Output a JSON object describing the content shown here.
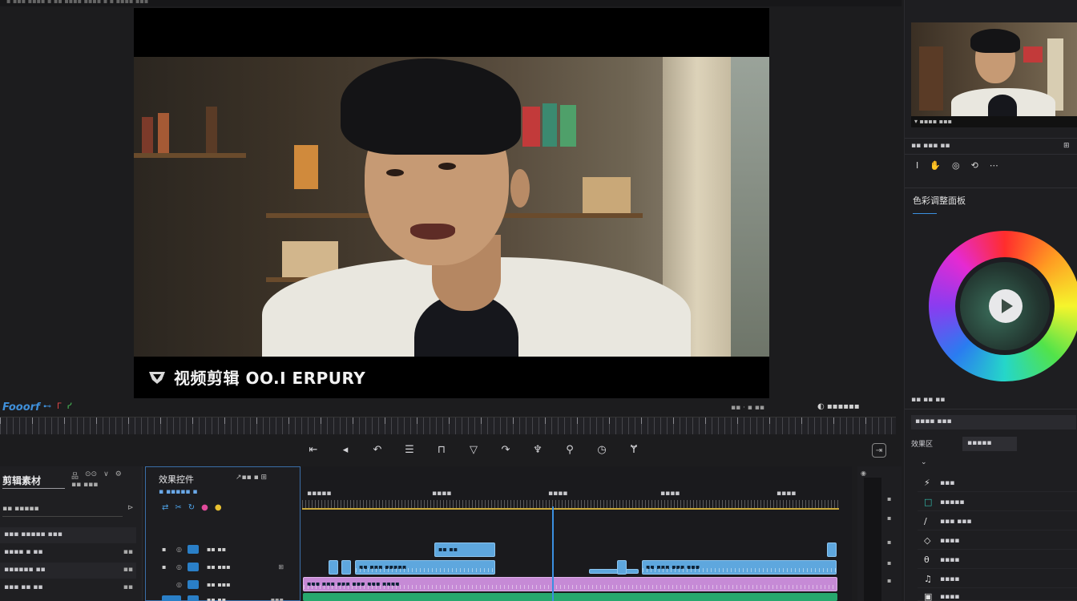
{
  "topbar": {
    "text": "▪ ▪▪▪ ▪▪▪▪ ▪ ▪▪ ▪▪▪▪ ▪▪▪▪ ▪ ▪ ▪▪▪▪ ▪▪▪"
  },
  "program": {
    "caption_text": "视频剪辑 OO.I ERPURY",
    "caption_icon": "shield-logo-icon"
  },
  "monitor_footer": {
    "brand": "Fooorf",
    "time_left": "▪▪ · ▪ ▪▪",
    "time_right": "◐ ▪▪▪▪▪▪"
  },
  "transport": {
    "buttons": [
      {
        "label": "⇤",
        "icon": "mark-in-icon"
      },
      {
        "label": "◂",
        "icon": "step-back-icon"
      },
      {
        "label": "↶",
        "icon": "rewind-icon"
      },
      {
        "label": "☰",
        "icon": "list-icon"
      },
      {
        "label": "⊓",
        "icon": "mark-out-icon"
      },
      {
        "label": "▽",
        "icon": "filter-icon"
      },
      {
        "label": "↷",
        "icon": "forward-icon"
      },
      {
        "label": "♆",
        "icon": "trim-icon"
      },
      {
        "label": "⚲",
        "icon": "extract-icon"
      },
      {
        "label": "◷",
        "icon": "clock-icon"
      },
      {
        "label": "Ɏ",
        "icon": "lift-icon"
      }
    ],
    "export_label": "⇥"
  },
  "project": {
    "title": "剪辑素材",
    "tools": [
      "品",
      "⊙⊙",
      "∨",
      "⚙"
    ],
    "sub": "▪▪ ▪▪▪",
    "search": "▪▪ ▪▪▪▪▪",
    "rows": [
      {
        "label": "▪▪▪ ▪▪▪▪▪ ▪▪▪",
        "right": ""
      },
      {
        "label": "▪▪▪▪ ▪ ▪▪",
        "right": "▪▪"
      },
      {
        "label": "▪▪▪▪▪▪ ▪▪",
        "right": "▪▪"
      },
      {
        "label": "▪▪▪ ▪▪ ▪▪",
        "right": "▪▪"
      }
    ]
  },
  "fx": {
    "title": "效果控件",
    "title_right": "↗▪▪ ▪ ⊞",
    "sub": "▪ ▪▪▪▪▪ ▪",
    "tools": [
      "⇄",
      "✂",
      "↻",
      "●",
      "●"
    ],
    "tracks": [
      {
        "lbl": "▪",
        "ic": "◎",
        "name": "▪▪ ▪▪",
        "r": ""
      },
      {
        "lbl": "▪",
        "ic": "◎",
        "name": "▪▪ ▪▪▪",
        "r": "⊞"
      },
      {
        "lbl": "",
        "ic": "◎",
        "name": "▪▪ ▪▪▪",
        "r": ""
      },
      {
        "lbl": "",
        "ic": "",
        "name": "▪▪ ▪▪",
        "r": "▪▪▪"
      }
    ]
  },
  "timeline": {
    "labels": [
      "▪▪▪▪▪",
      "▪▪▪▪",
      "▪▪▪▪",
      "▪▪▪▪",
      "▪▪▪▪"
    ],
    "clips": {
      "c1": "▪▪ ▪▪",
      "c2": "▪▪ ▪▪▪ ▪▪▪▪▪",
      "c3": "▪▪ ▪▪▪ ▪▪▪ ▪▪▪",
      "c4": "▪▪▪ ▪▪▪ ▪▪▪ ▪▪▪ ▪▪▪ ▪▪▪▪"
    }
  },
  "meter": {
    "labels": [
      "▪",
      "▪",
      "▪",
      "▪",
      "▪"
    ]
  },
  "right": {
    "thumb_bar": "▾ ▪▪▪▪ ▪▪▪",
    "row1": "▪▪ ▪▪▪ ▪▪",
    "tools": [
      "I",
      "✋",
      "◎",
      "⟲",
      "⋯"
    ],
    "color_title": "色彩调整面板",
    "wheel_label": "▪▪ ▪▪ ▪▪",
    "panel_btn": "▪▪▪▪ ▪▪▪",
    "tab1": "效果区",
    "tab2": "▪▪▪▪▪",
    "items": [
      {
        "icon": "⚡",
        "label": "▪▪▪"
      },
      {
        "icon": "□",
        "label": "▪▪▪▪▪"
      },
      {
        "icon": "∕",
        "label": "▪▪▪ ▪▪▪"
      },
      {
        "icon": "◇",
        "label": "▪▪▪▪"
      },
      {
        "icon": "θ",
        "label": "▪▪▪▪"
      },
      {
        "icon": "♫",
        "label": "▪▪▪▪"
      },
      {
        "icon": "▣",
        "label": "▪▪▪▪"
      }
    ]
  },
  "colors": {
    "accent": "#3b8fe0",
    "clip_blue": "#5ea7de",
    "clip_pink": "#c68ad6",
    "clip_green": "#27a86e"
  }
}
